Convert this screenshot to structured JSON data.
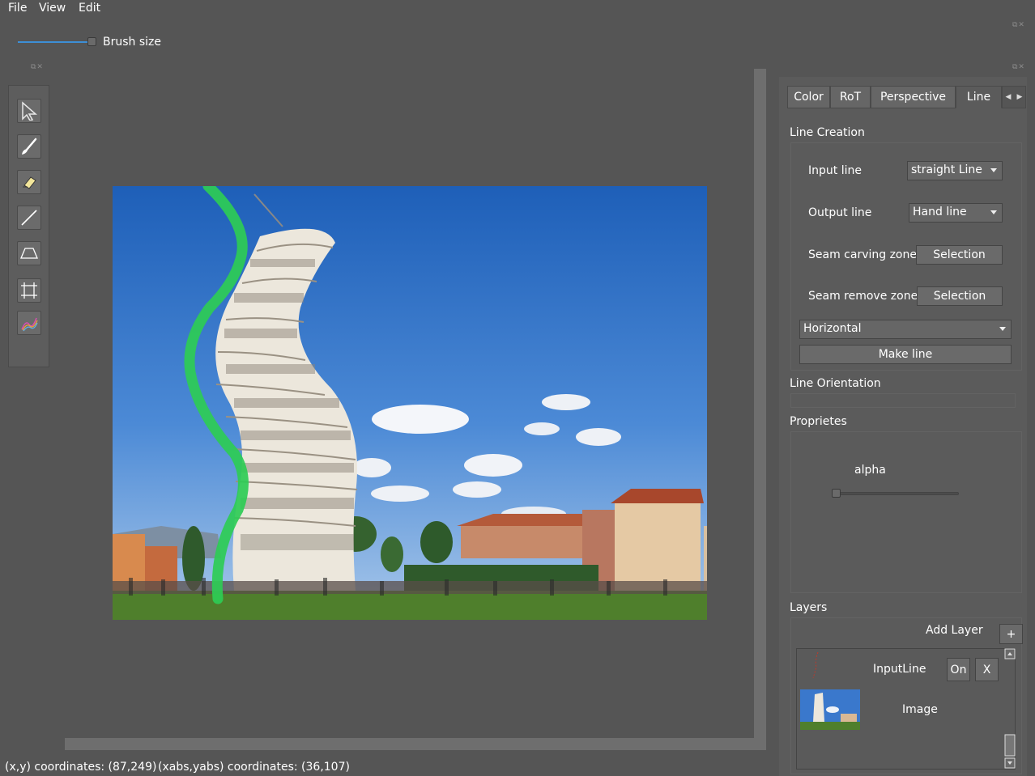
{
  "menu": [
    "File",
    "View",
    "Edit"
  ],
  "brush": {
    "label": "Brush size"
  },
  "tools": [
    {
      "name": "select-arrow-icon"
    },
    {
      "name": "brush-icon"
    },
    {
      "name": "eraser-icon"
    },
    {
      "name": "line-icon"
    },
    {
      "name": "perspective-icon"
    },
    {
      "name": "crop-icon"
    },
    {
      "name": "color-spray-icon"
    }
  ],
  "status": {
    "xy": "(x,y) coordinates: (87,249)",
    "abs": "(xabs,yabs) coordinates: (36,107)"
  },
  "tabs": [
    "Color",
    "RoT",
    "Perspective",
    "Line"
  ],
  "active_tab": "Line",
  "line_creation": {
    "title": "Line Creation",
    "input_label": "Input line",
    "input_value": "straight Line",
    "output_label": "Output line",
    "output_value": "Hand line",
    "seam_carving_label": "Seam carving zone",
    "seam_carving_button": "Selection",
    "seam_remove_label": "Seam remove zone",
    "seam_remove_button": "Selection",
    "orientation_value": "Horizontal",
    "make_line": "Make line"
  },
  "line_orientation": {
    "title": "Line Orientation"
  },
  "properties": {
    "title": "Proprietes",
    "alpha_label": "alpha",
    "alpha_value": 0
  },
  "layers": {
    "title": "Layers",
    "add_label": "Add Layer",
    "add_button": "+",
    "items": [
      {
        "name": "InputLine",
        "on": "On",
        "remove": "X"
      },
      {
        "name": "Image"
      }
    ]
  },
  "colors": {
    "background": "#555555",
    "accent": "#3d8fd6",
    "stroke_green": "#2ecc55"
  }
}
